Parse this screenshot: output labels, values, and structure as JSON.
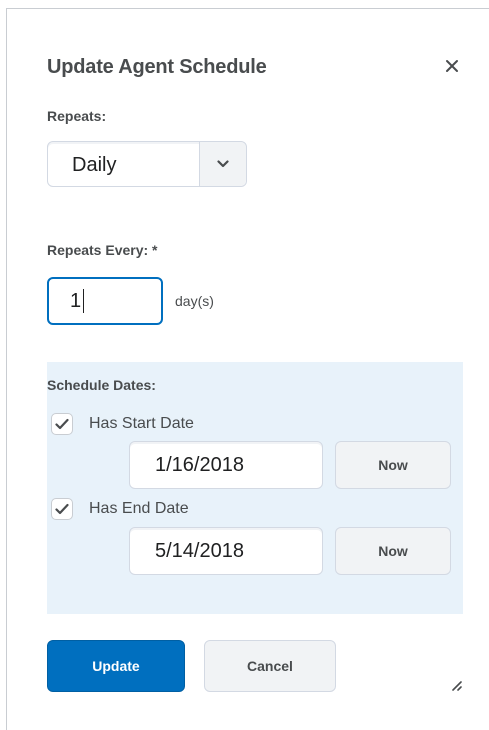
{
  "dialog": {
    "title": "Update Agent Schedule"
  },
  "repeats": {
    "label": "Repeats:",
    "selected": "Daily"
  },
  "repeats_every": {
    "label": "Repeats Every: *",
    "value": "1",
    "unit": "day(s)"
  },
  "schedule_dates": {
    "label": "Schedule Dates:",
    "start": {
      "checkbox_label": "Has Start Date",
      "checked": true,
      "date": "1/16/2018",
      "now_label": "Now"
    },
    "end": {
      "checkbox_label": "Has End Date",
      "checked": true,
      "date": "5/14/2018",
      "now_label": "Now"
    }
  },
  "footer": {
    "update_label": "Update",
    "cancel_label": "Cancel"
  },
  "colors": {
    "primary": "#006fbf",
    "panel_bg": "#e8f2fa",
    "text": "#494c4e"
  }
}
